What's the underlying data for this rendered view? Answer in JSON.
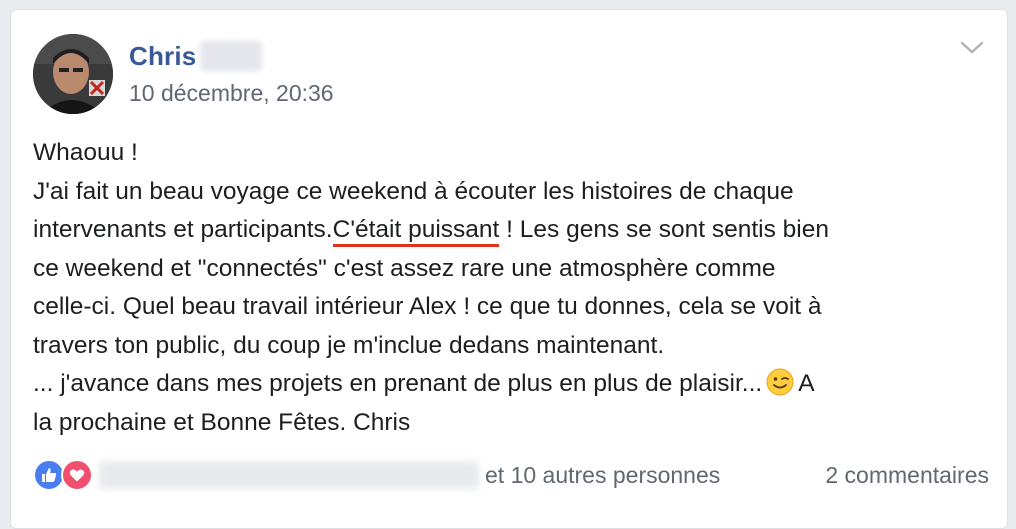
{
  "post": {
    "author_name": "Chris",
    "timestamp": "10 décembre, 20:36",
    "body": {
      "line1": "Whaouu !",
      "line2": "J'ai fait un beau voyage ce weekend à écouter les histoires de chaque",
      "line3_pre": "intervenants et participants.",
      "line3_underlined": "C'était puissant",
      "line3_post": " ! Les gens se sont sentis bien",
      "line4": "ce weekend et \"connectés\" c'est assez rare une atmosphère comme",
      "line5": "celle-ci. Quel beau travail intérieur Alex ! ce que tu donnes, cela se voit à",
      "line6": "travers ton public, du coup je m'inclue dedans maintenant.",
      "line7_pre": "... j'avance dans mes projets en prenant de plus en plus de plaisir...",
      "line7_post": "A",
      "line8": "la prochaine et Bonne Fêtes. Chris"
    },
    "reactions": {
      "icons": [
        "like-icon",
        "love-icon"
      ],
      "others_label": "et 10 autres personnes",
      "comments_label": "2 commentaires"
    }
  },
  "colors": {
    "name_link": "#385898",
    "meta_gray": "#616770",
    "text": "#1c1e21",
    "underline": "#e0301e",
    "like_blue": "#4a7ef0",
    "love_red": "#f0506e"
  }
}
